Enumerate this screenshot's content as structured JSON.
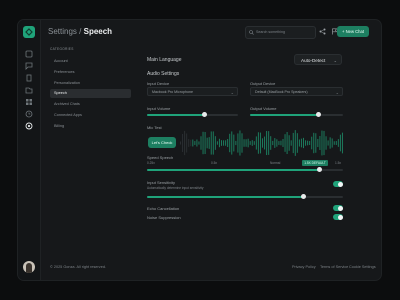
{
  "header": {
    "breadcrumb_parent": "Settings",
    "breadcrumb_sep": "/",
    "breadcrumb_current": "Speech",
    "search_placeholder": "Search something",
    "new_chat_label": "+ New Chat"
  },
  "sidebar_nav": {
    "title": "CATEGORIES",
    "items": [
      {
        "label": "Account",
        "active": false
      },
      {
        "label": "Preferences",
        "active": false
      },
      {
        "label": "Personalization",
        "active": false
      },
      {
        "label": "Speech",
        "active": true
      },
      {
        "label": "Archived Chats",
        "active": false
      },
      {
        "label": "Connected Apps",
        "active": false
      },
      {
        "label": "Billing",
        "active": false
      }
    ]
  },
  "speech": {
    "main_language_label": "Main Language",
    "main_language_value": "Auto-Detect",
    "audio_settings_label": "Audio Settings",
    "input_device_label": "Input Device",
    "input_device_value": "Macbook Pro Microphone",
    "output_device_label": "Output Device",
    "output_device_value": "Default (MacBook Pro Speakers)",
    "input_volume_label": "Input Volume",
    "input_volume_pct": 0.63,
    "output_volume_label": "Output Volume",
    "output_volume_pct": 0.74,
    "mic_test_label": "Mic Test",
    "lets_check_label": "Let's Check",
    "speed_label": "Speed Speech",
    "speed_ticks": [
      "0.25x",
      "0.5x",
      "Normal",
      "1.5x"
    ],
    "speed_tag": "1.5X DEFAULT",
    "speed_pct": 0.88,
    "input_sensitivity_label": "Input Sensitivity",
    "input_sensitivity_sub": "Automatically determine input sensitivity",
    "input_sensitivity_on": true,
    "input_sensitivity_pct": 0.8,
    "echo_label": "Echo Cancellation",
    "echo_on": true,
    "noise_label": "Noise Suppression",
    "noise_on": true
  },
  "footer": {
    "copyright": "© 2025 Gonza. All right reserved.",
    "links": [
      "Privacy Policy",
      "Terms of Service",
      "Cookie Settings"
    ]
  },
  "colors": {
    "accent": "#1fa37a",
    "background": "#16181a"
  }
}
